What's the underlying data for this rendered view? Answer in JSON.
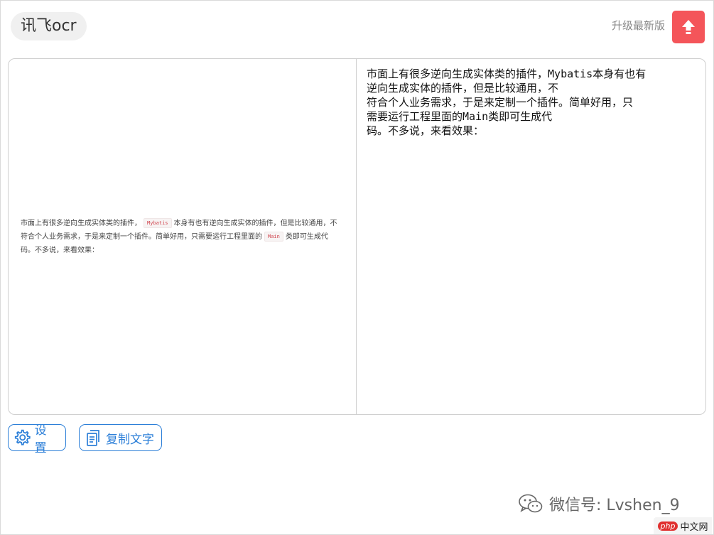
{
  "header": {
    "app_title": "讯飞ocr",
    "upgrade_label": "升级最新版",
    "upload_icon": "arrow-up-icon"
  },
  "source_image": {
    "line1_a": "市面上有很多逆向生成实体类的插件，",
    "line1_code": "Mybatis",
    "line1_b": "本身有也有逆向生成实体的插件，但是比较通用，不",
    "line2_a": "符合个人业务需求，于是来定制一个插件。简单好用，只需要运行工程里面的",
    "line2_code": "Main",
    "line2_b": "类即可生成代",
    "line3": "码。不多说，来看效果："
  },
  "result": {
    "text": "市面上有很多逆向生成实体类的插件，Mybatis本身有也有\n逆向生成实体的插件，但是比较通用，不\n符合个人业务需求，于是来定制一个插件。简单好用，只\n需要运行工程里面的Main类即可生成代\n码。不多说，来看效果："
  },
  "actions": {
    "settings_label": "设置",
    "copy_label": "复制文字"
  },
  "watermark": {
    "text": "微信号: Lvshen_9"
  },
  "badge": {
    "php": "php",
    "site": "中文网"
  },
  "colors": {
    "accent": "#2c7fd8",
    "upload_bg": "#f4555a"
  }
}
